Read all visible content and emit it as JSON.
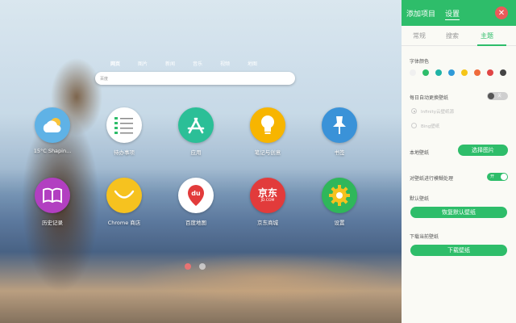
{
  "search": {
    "tabs": [
      "网页",
      "图片",
      "新闻",
      "音乐",
      "视频",
      "地图"
    ],
    "active_tab_index": 0,
    "engine_label": "百度",
    "placeholder": ""
  },
  "apps": [
    {
      "label": "15°C Shapin...",
      "icon": "weather-cloud-icon",
      "color": "#5fb2e6"
    },
    {
      "label": "待办事项",
      "icon": "todo-list-icon",
      "color": "#ffffff"
    },
    {
      "label": "应用",
      "icon": "app-store-icon",
      "color": "#2bbf97"
    },
    {
      "label": "笔记与创意",
      "icon": "lightbulb-icon",
      "color": "#f7b500"
    },
    {
      "label": "书签",
      "icon": "pin-icon",
      "color": "#3a92d8"
    },
    {
      "label": "历史记录",
      "icon": "book-icon",
      "color": "#b23fc1"
    },
    {
      "label": "Chrome 商店",
      "icon": "shopping-bag-icon",
      "color": "#f6c21f"
    },
    {
      "label": "百度地图",
      "icon": "map-pin-icon",
      "color": "#ffffff"
    },
    {
      "label": "京东商城",
      "icon": "jd-logo-icon",
      "color": "#e23b3b",
      "logo_text": "京东",
      "logo_sub": "JD.COM"
    },
    {
      "label": "设置",
      "icon": "gear-icon",
      "color": "#2fb75a"
    }
  ],
  "pager": {
    "pages": 2,
    "active": 0
  },
  "panel": {
    "header_tabs": [
      "添加项目",
      "设置"
    ],
    "active_header_tab": 1,
    "sub_tabs": [
      "常规",
      "搜索",
      "主题"
    ],
    "active_sub_tab": 2,
    "font_color_label": "字体颜色",
    "font_colors": [
      "#f0f0f0",
      "#2ebd6a",
      "#20b3a6",
      "#2f9ad8",
      "#f5c518",
      "#ef6b3b",
      "#e04545",
      "#444444"
    ],
    "daily_wallpaper_label": "每日自动更换壁纸",
    "daily_wallpaper_toggle": "关",
    "source_options": [
      "Infinity云壁纸源",
      "Bing壁纸"
    ],
    "local_wallpaper_label": "本地壁纸",
    "choose_image_button": "选择图片",
    "blur_label": "对壁纸进行模糊处理",
    "blur_toggle": "开",
    "default_wallpaper_label": "默认壁纸",
    "restore_default_button": "恢复默认壁纸",
    "download_label": "下载当前壁纸",
    "download_button": "下载壁纸",
    "close_icon": "close-icon"
  }
}
